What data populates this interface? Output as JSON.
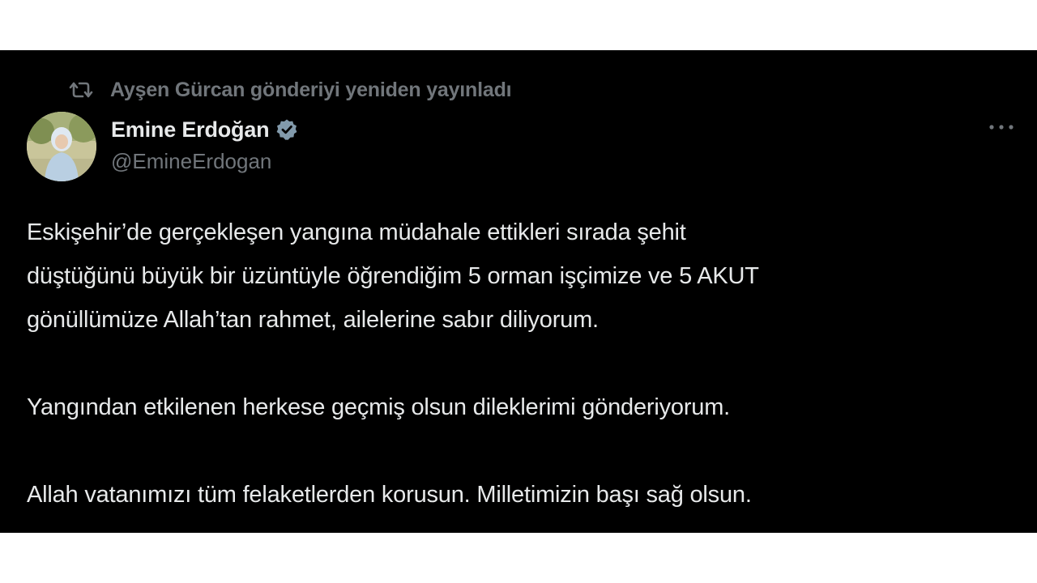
{
  "repost": {
    "icon": "repost-icon",
    "text": "Ayşen Gürcan gönderiyi yeniden yayınladı"
  },
  "author": {
    "avatar_icon": "avatar",
    "display_name": "Emine Erdoğan",
    "verified_icon": "verified-badge-icon",
    "handle": "@EmineErdogan"
  },
  "menu": {
    "icon": "more-icon"
  },
  "tweet": {
    "lines": [
      "Eskişehir’de gerçekleşen yangına müdahale ettikleri sırada şehit",
      "düştüğünü büyük bir üzüntüyle öğrendiğim 5 orman işçimize ve 5 AKUT",
      "gönüllümüze Allah’tan rahmet, ailelerine sabır diliyorum.",
      "Yangından etkilenen herkese geçmiş olsun dileklerimi gönderiyorum.",
      "Allah vatanımızı tüm felaketlerden korusun. Milletimizin başı sağ olsun."
    ]
  },
  "colors": {
    "background": "#000000",
    "text": "#e7e9ea",
    "muted": "#71767b",
    "verified": "#829aab"
  }
}
